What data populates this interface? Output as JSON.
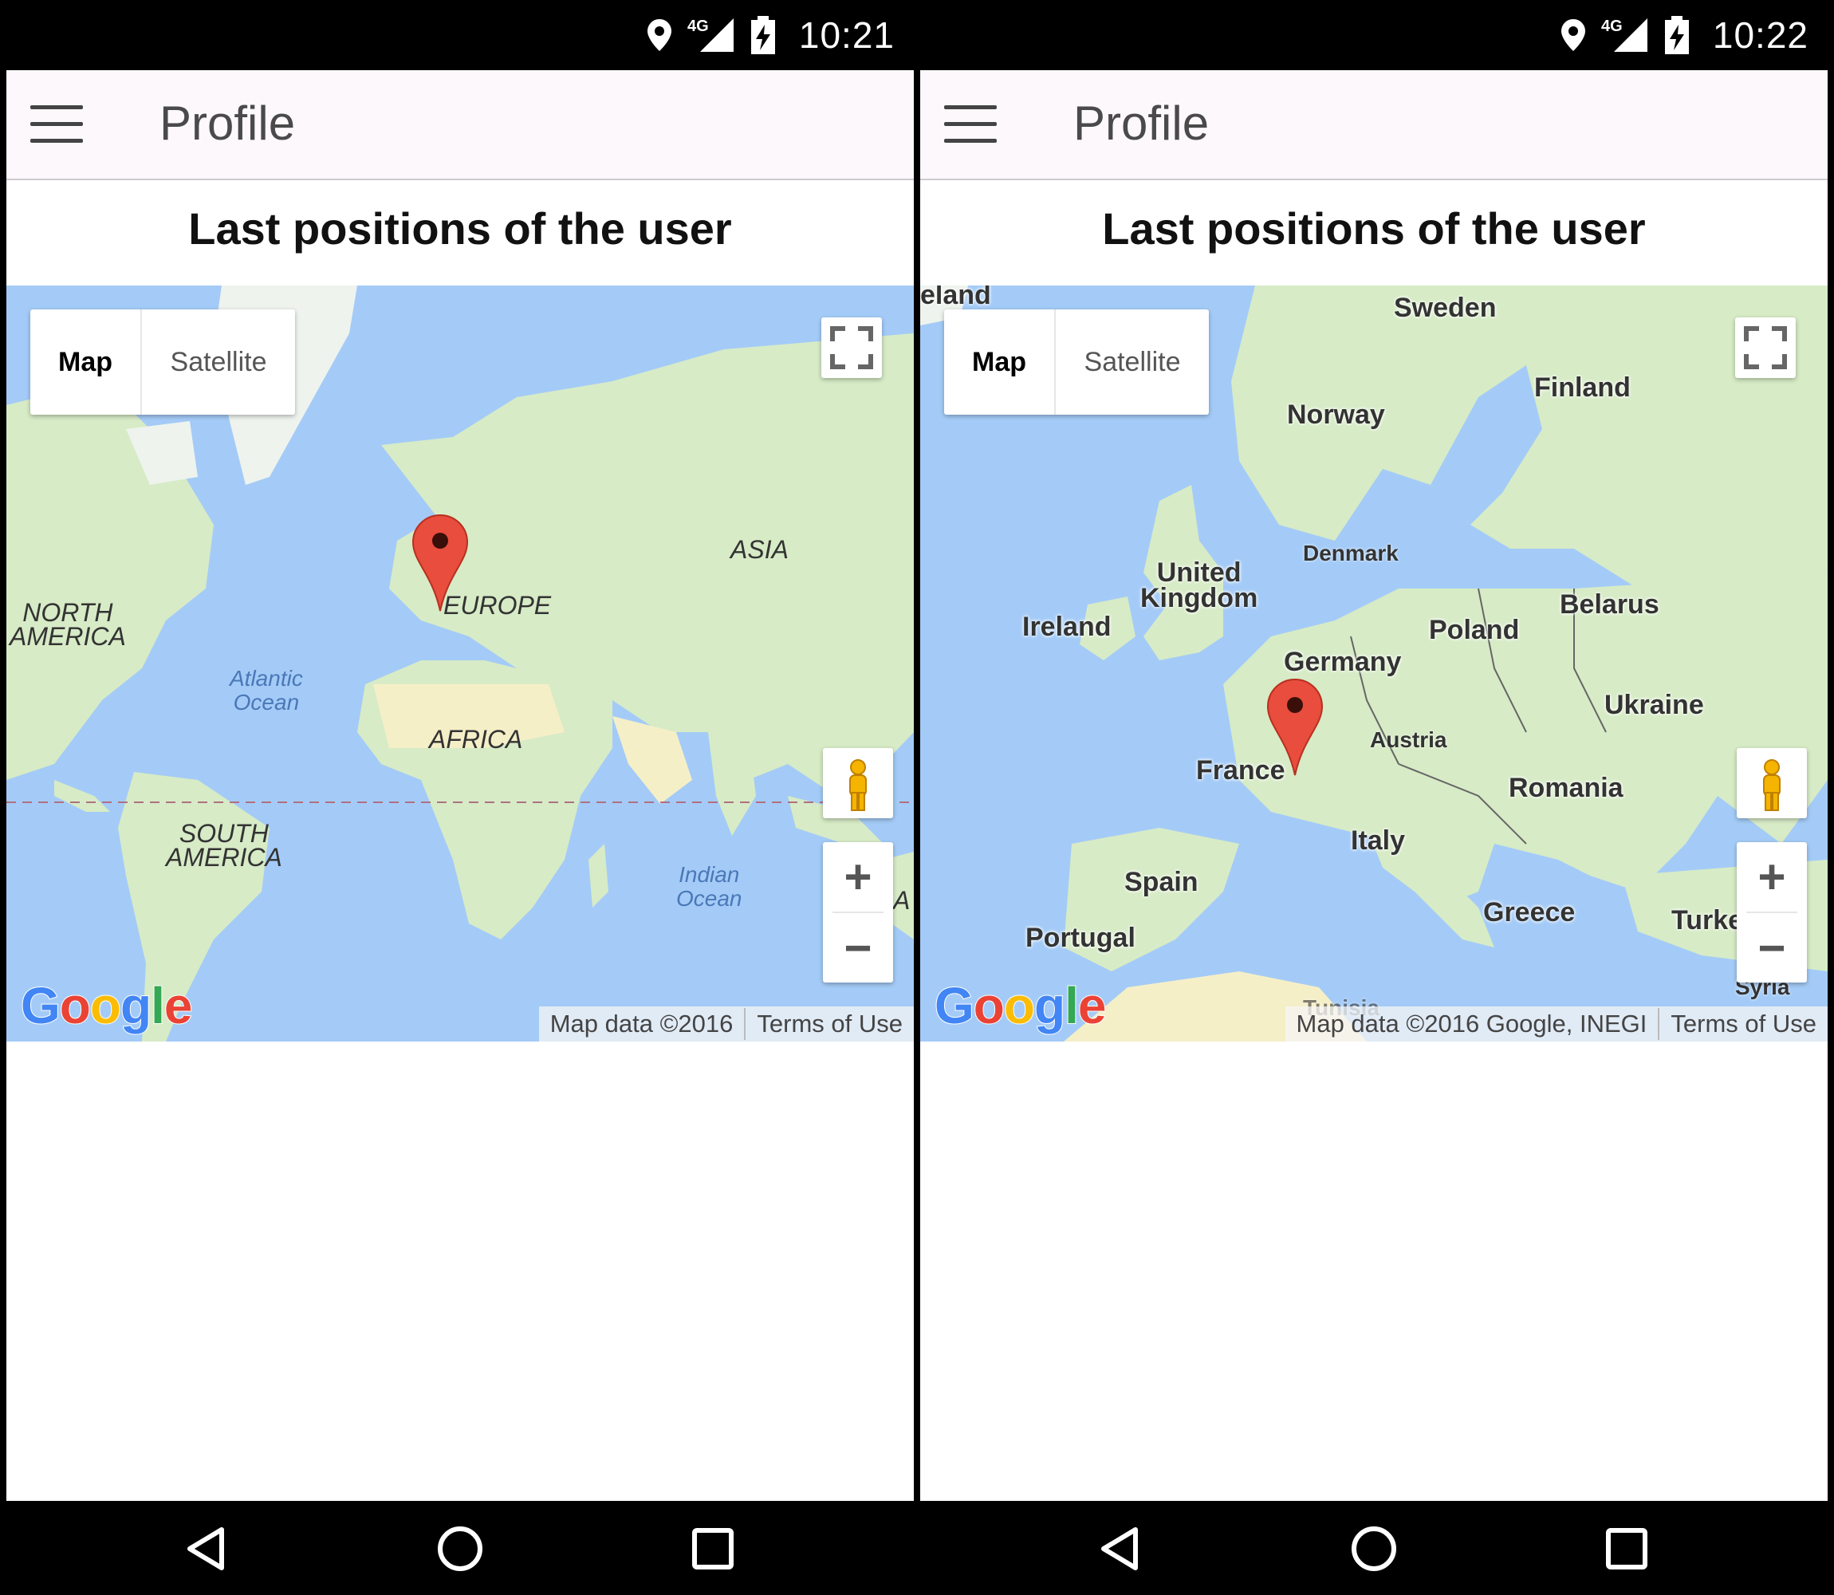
{
  "screens": [
    {
      "status": {
        "network": "4G",
        "time": "10:21"
      },
      "appbar": {
        "title": "Profile"
      },
      "heading": "Last positions of the user",
      "map": {
        "type_map": "Map",
        "type_satellite": "Satellite",
        "labels": {
          "north_america": "NORTH\nAMERICA",
          "south_america": "SOUTH\nAMERICA",
          "europe": "EUROPE",
          "asia": "ASIA",
          "africa": "AFRICA",
          "atlantic": "Atlantic\nOcean",
          "indian": "Indian\nOcean",
          "aus_partial": "A"
        },
        "google": "Google",
        "attribution": "Map data ©2016",
        "terms": "Terms of Use"
      }
    },
    {
      "status": {
        "network": "4G",
        "time": "10:22"
      },
      "appbar": {
        "title": "Profile"
      },
      "heading": "Last positions of the user",
      "map": {
        "type_map": "Map",
        "type_satellite": "Satellite",
        "labels": {
          "iceland": "eland",
          "sweden": "Sweden",
          "finland": "Finland",
          "norway": "Norway",
          "denmark": "Denmark",
          "uk": "United\nKingdom",
          "ireland": "Ireland",
          "belarus": "Belarus",
          "poland": "Poland",
          "germany": "Germany",
          "ukraine": "Ukraine",
          "austria": "Austria",
          "france": "France",
          "romania": "Romania",
          "italy": "Italy",
          "spain": "Spain",
          "portugal": "Portugal",
          "greece": "Greece",
          "turkey": "Turke",
          "syria": "Syria",
          "tunisia": "Tunisia"
        },
        "google": "Google",
        "attribution": "Map data ©2016 Google, INEGI",
        "terms": "Terms of Use"
      }
    }
  ],
  "colors": {
    "water": "#a4cbf7",
    "land": "#d7ebc6",
    "desert": "#f5efc8",
    "pin": "#e84d3d",
    "appbar": "#fcf8fc"
  },
  "icons": [
    "location-icon",
    "signal-4g-icon",
    "battery-charging-icon",
    "menu-icon",
    "fullscreen-icon",
    "pegman-icon",
    "zoom-in-icon",
    "zoom-out-icon",
    "map-pin-icon",
    "back-icon",
    "home-icon",
    "recents-icon"
  ]
}
